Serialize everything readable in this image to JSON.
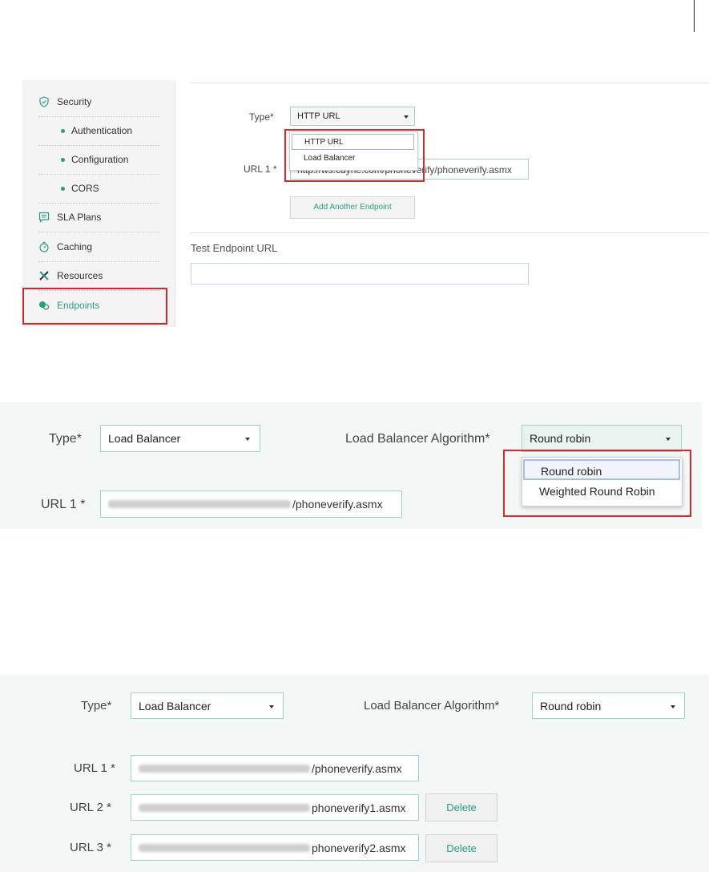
{
  "colors": {
    "accent": "#2a9d84",
    "highlight_border": "#d9262b",
    "field_border": "#9fd4c5"
  },
  "panel1": {
    "sidebar": [
      {
        "label": "Security",
        "icon": "shield-check-icon"
      },
      {
        "label": "Authentication",
        "icon": "bullet"
      },
      {
        "label": "Configuration",
        "icon": "bullet"
      },
      {
        "label": "CORS",
        "icon": "bullet"
      },
      {
        "label": "SLA Plans",
        "icon": "message-icon"
      },
      {
        "label": "Caching",
        "icon": "stopwatch-icon"
      },
      {
        "label": "Resources",
        "icon": "tools-icon"
      },
      {
        "label": "Endpoints",
        "icon": "endpoints-icon"
      }
    ],
    "type_label": "Type*",
    "type_value": "HTTP URL",
    "type_options": [
      "HTTP URL",
      "Load Balancer"
    ],
    "url1_label": "URL 1 *",
    "url1_value": "http://ws.cdyne.com/phoneverify/phoneverify.asmx",
    "add_endpoint": "Add Another Endpoint",
    "test_label": "Test Endpoint URL",
    "test_value": ""
  },
  "panel2": {
    "type_label": "Type*",
    "type_value": "Load Balancer",
    "algo_label": "Load Balancer Algorithm*",
    "algo_value": "Round robin",
    "algo_options": [
      "Round robin",
      "Weighted Round Robin"
    ],
    "url1_label": "URL 1 *",
    "url1_suffix": "/phoneverify.asmx"
  },
  "panel3": {
    "type_label": "Type*",
    "type_value": "Load Balancer",
    "algo_label": "Load Balancer Algorithm*",
    "algo_value": "Round robin",
    "urls": [
      {
        "label": "URL 1 *",
        "suffix": "/phoneverify.asmx",
        "delete": ""
      },
      {
        "label": "URL 2 *",
        "suffix": "phoneverify1.asmx",
        "delete": "Delete"
      },
      {
        "label": "URL 3 *",
        "suffix": "phoneverify2.asmx",
        "delete": "Delete"
      }
    ]
  }
}
